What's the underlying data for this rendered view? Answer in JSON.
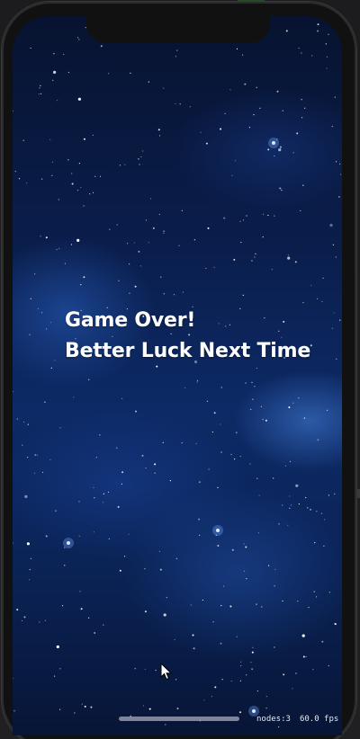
{
  "app": {
    "platform": "iOS Simulator",
    "background": "starfield"
  },
  "game_over": {
    "line1": "Game Over!",
    "line2": "Better Luck Next Time"
  },
  "debug": {
    "nodes": "nodes:3",
    "fps": "60.0 fps"
  },
  "colors": {
    "text": "#ffffff",
    "space_dark": "#071330",
    "space_blue": "#0d2a66",
    "nebula": "#4682dc"
  }
}
